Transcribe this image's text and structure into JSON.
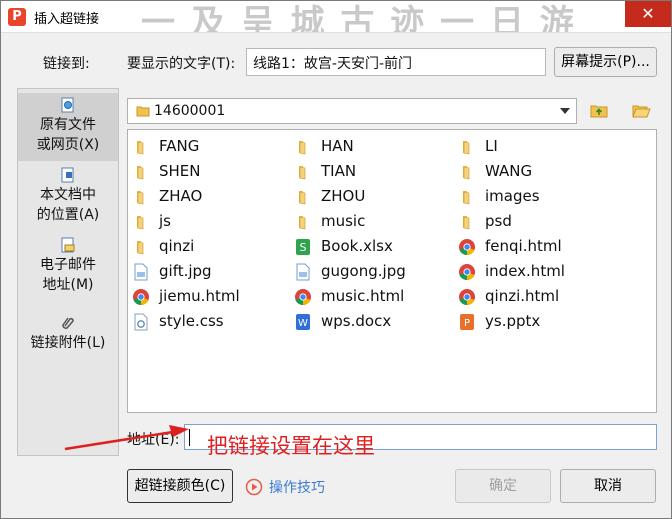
{
  "window": {
    "title": "插入超链接",
    "bg_text": "一 及 呈 城 古 迹 一 日 游"
  },
  "link_to": {
    "label": "链接到:"
  },
  "display_text": {
    "label": "要显示的文字(T):",
    "value": "线路1：故宫-天安门-前门"
  },
  "screen_tip_button": "屏幕提示(P)...",
  "sidebar": {
    "items": [
      {
        "label1": "原有文件",
        "label2": "或网页(X)",
        "icon": "web-page-icon",
        "active": true
      },
      {
        "label1": "本文档中",
        "label2": "的位置(A)",
        "icon": "document-location-icon",
        "active": false
      },
      {
        "label1": "电子邮件",
        "label2": "地址(M)",
        "icon": "email-icon",
        "active": false
      },
      {
        "label1": "链接附件(L)",
        "label2": "",
        "icon": "paperclip-icon",
        "active": false
      }
    ]
  },
  "path": {
    "current": "14600001"
  },
  "files": [
    {
      "name": "FANG",
      "type": "folder"
    },
    {
      "name": "HAN",
      "type": "folder"
    },
    {
      "name": "LI",
      "type": "folder"
    },
    {
      "name": "SHEN",
      "type": "folder"
    },
    {
      "name": "TIAN",
      "type": "folder"
    },
    {
      "name": "WANG",
      "type": "folder"
    },
    {
      "name": "ZHAO",
      "type": "folder"
    },
    {
      "name": "ZHOU",
      "type": "folder"
    },
    {
      "name": "images",
      "type": "folder"
    },
    {
      "name": "js",
      "type": "folder"
    },
    {
      "name": "music",
      "type": "folder"
    },
    {
      "name": "psd",
      "type": "folder"
    },
    {
      "name": "qinzi",
      "type": "folder"
    },
    {
      "name": "Book.xlsx",
      "type": "xlsx"
    },
    {
      "name": "fenqi.html",
      "type": "html"
    },
    {
      "name": "gift.jpg",
      "type": "image"
    },
    {
      "name": "gugong.jpg",
      "type": "image"
    },
    {
      "name": "index.html",
      "type": "html"
    },
    {
      "name": "jiemu.html",
      "type": "html"
    },
    {
      "name": "music.html",
      "type": "html"
    },
    {
      "name": "qinzi.html",
      "type": "html"
    },
    {
      "name": "style.css",
      "type": "css"
    },
    {
      "name": "wps.docx",
      "type": "docx"
    },
    {
      "name": "ys.pptx",
      "type": "pptx"
    }
  ],
  "address": {
    "label": "地址(E):",
    "value": ""
  },
  "annotation": "把链接设置在这里",
  "buttons": {
    "link_color": "超链接颜色(C)",
    "tips": "操作技巧",
    "ok": "确定",
    "cancel": "取消"
  },
  "colors": {
    "accent": "#e8452c",
    "annotation": "#e02020",
    "folder": "#f2c14e",
    "link": "#3a7bd5"
  }
}
